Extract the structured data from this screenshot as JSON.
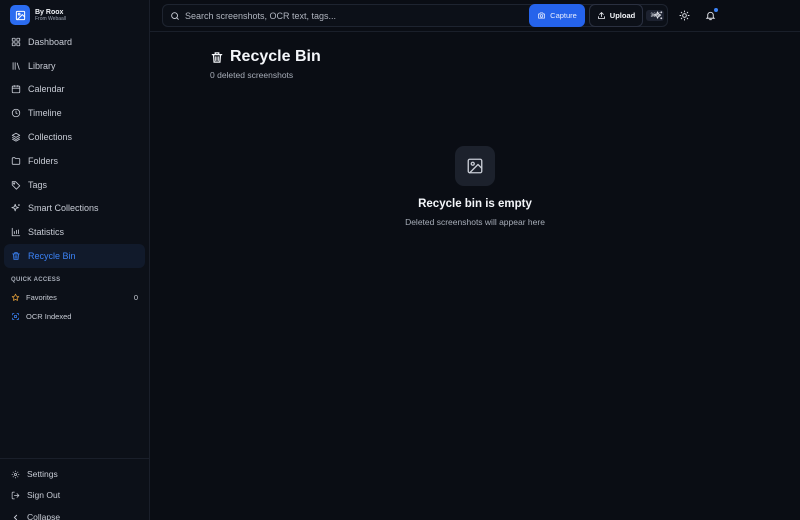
{
  "brand": {
    "name": "By Roox",
    "subtitle": "From Webaall"
  },
  "nav": [
    {
      "label": "Dashboard",
      "icon": "dashboard-icon",
      "active": false
    },
    {
      "label": "Library",
      "icon": "library-icon",
      "active": false
    },
    {
      "label": "Calendar",
      "icon": "calendar-icon",
      "active": false
    },
    {
      "label": "Timeline",
      "icon": "clock-icon",
      "active": false
    },
    {
      "label": "Collections",
      "icon": "layers-icon",
      "active": false
    },
    {
      "label": "Folders",
      "icon": "folder-icon",
      "active": false
    },
    {
      "label": "Tags",
      "icon": "tag-icon",
      "active": false
    },
    {
      "label": "Smart Collections",
      "icon": "sparkles-icon",
      "active": false
    },
    {
      "label": "Statistics",
      "icon": "bar-chart-icon",
      "active": false
    },
    {
      "label": "Recycle Bin",
      "icon": "trash-icon",
      "active": true
    }
  ],
  "quick_access": {
    "title": "QUICK ACCESS",
    "items": [
      {
        "label": "Favorites",
        "icon": "star-icon",
        "count": "0"
      },
      {
        "label": "OCR Indexed",
        "icon": "scan-icon",
        "count": ""
      }
    ]
  },
  "footer": {
    "settings": "Settings",
    "sign_out": "Sign Out",
    "collapse": "Collapse"
  },
  "header": {
    "search_placeholder": "Search screenshots, OCR text, tags...",
    "shortcut": "⌘K",
    "capture": "Capture",
    "upload": "Upload"
  },
  "page": {
    "title": "Recycle Bin",
    "subtitle": "0 deleted screenshots",
    "empty_title": "Recycle bin is empty",
    "empty_subtitle": "Deleted screenshots will appear here"
  },
  "colors": {
    "accent": "#2563eb",
    "active_text": "#3b82f6",
    "background": "#0a0d14",
    "sidebar": "#0c1018"
  }
}
